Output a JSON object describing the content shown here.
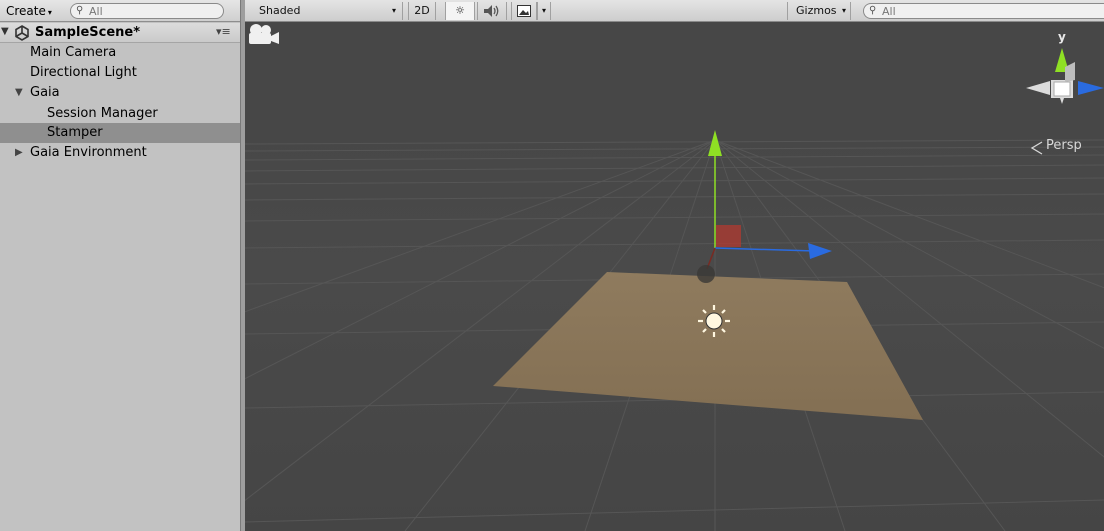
{
  "hierarchy": {
    "create_label": "Create",
    "search_placeholder": "All",
    "scene_name": "SampleScene*",
    "items": [
      {
        "label": "Main Camera"
      },
      {
        "label": "Directional Light"
      },
      {
        "label": "Gaia"
      },
      {
        "label": "Session Manager"
      },
      {
        "label": "Stamper"
      },
      {
        "label": "Gaia Environment"
      }
    ]
  },
  "scene_toolbar": {
    "draw_mode": "Shaded",
    "mode_2d": "2D",
    "gizmos_label": "Gizmos",
    "search_placeholder": "All"
  },
  "viewport": {
    "projection_label": "Persp",
    "axis_label_y": "y",
    "background_color": "#474747",
    "plane_color": "#8a7558",
    "axis_colors": {
      "x_red": "#c23a2b",
      "y_green": "#8fe024",
      "z_blue": "#2a6be0"
    }
  },
  "icons": [
    "search-icon",
    "unity-logo-icon",
    "hierarchy-menu-icon",
    "sun-lighting-icon",
    "audio-icon",
    "effects-image-icon",
    "directional-light-icon",
    "scene-camera-icon"
  ]
}
